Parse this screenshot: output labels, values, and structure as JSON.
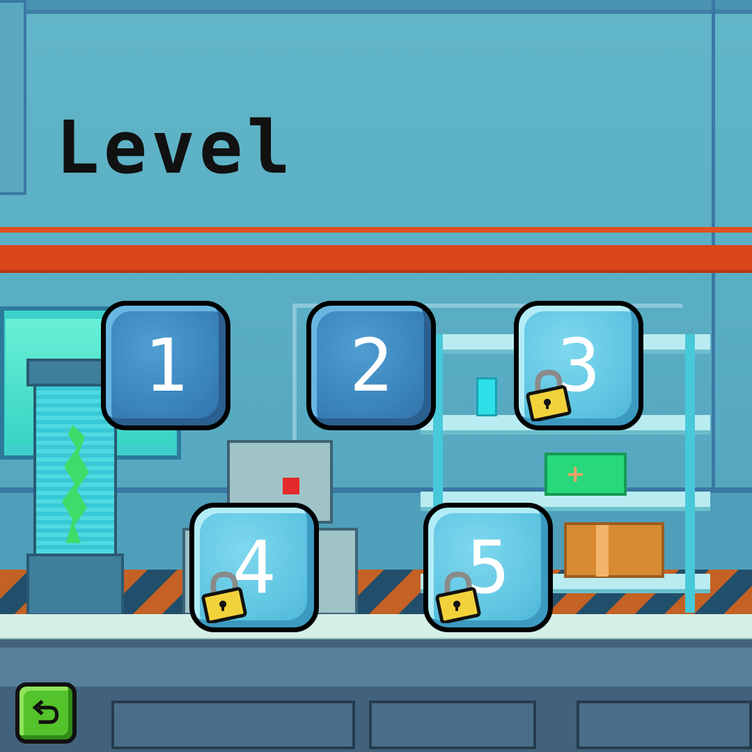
{
  "header": {
    "title": "Level"
  },
  "levels": [
    {
      "label": "1",
      "locked": false
    },
    {
      "label": "2",
      "locked": false
    },
    {
      "label": "3",
      "locked": true
    },
    {
      "label": "4",
      "locked": true
    },
    {
      "label": "5",
      "locked": true
    }
  ],
  "back_button": {
    "icon": "undo-arrow-icon"
  },
  "colors": {
    "wall": "#5aa9bf",
    "accent_stripe": "#d9471b",
    "unlocked_button": "#3a83bc",
    "locked_button": "#5fc5e2",
    "back_button": "#54c22a"
  }
}
